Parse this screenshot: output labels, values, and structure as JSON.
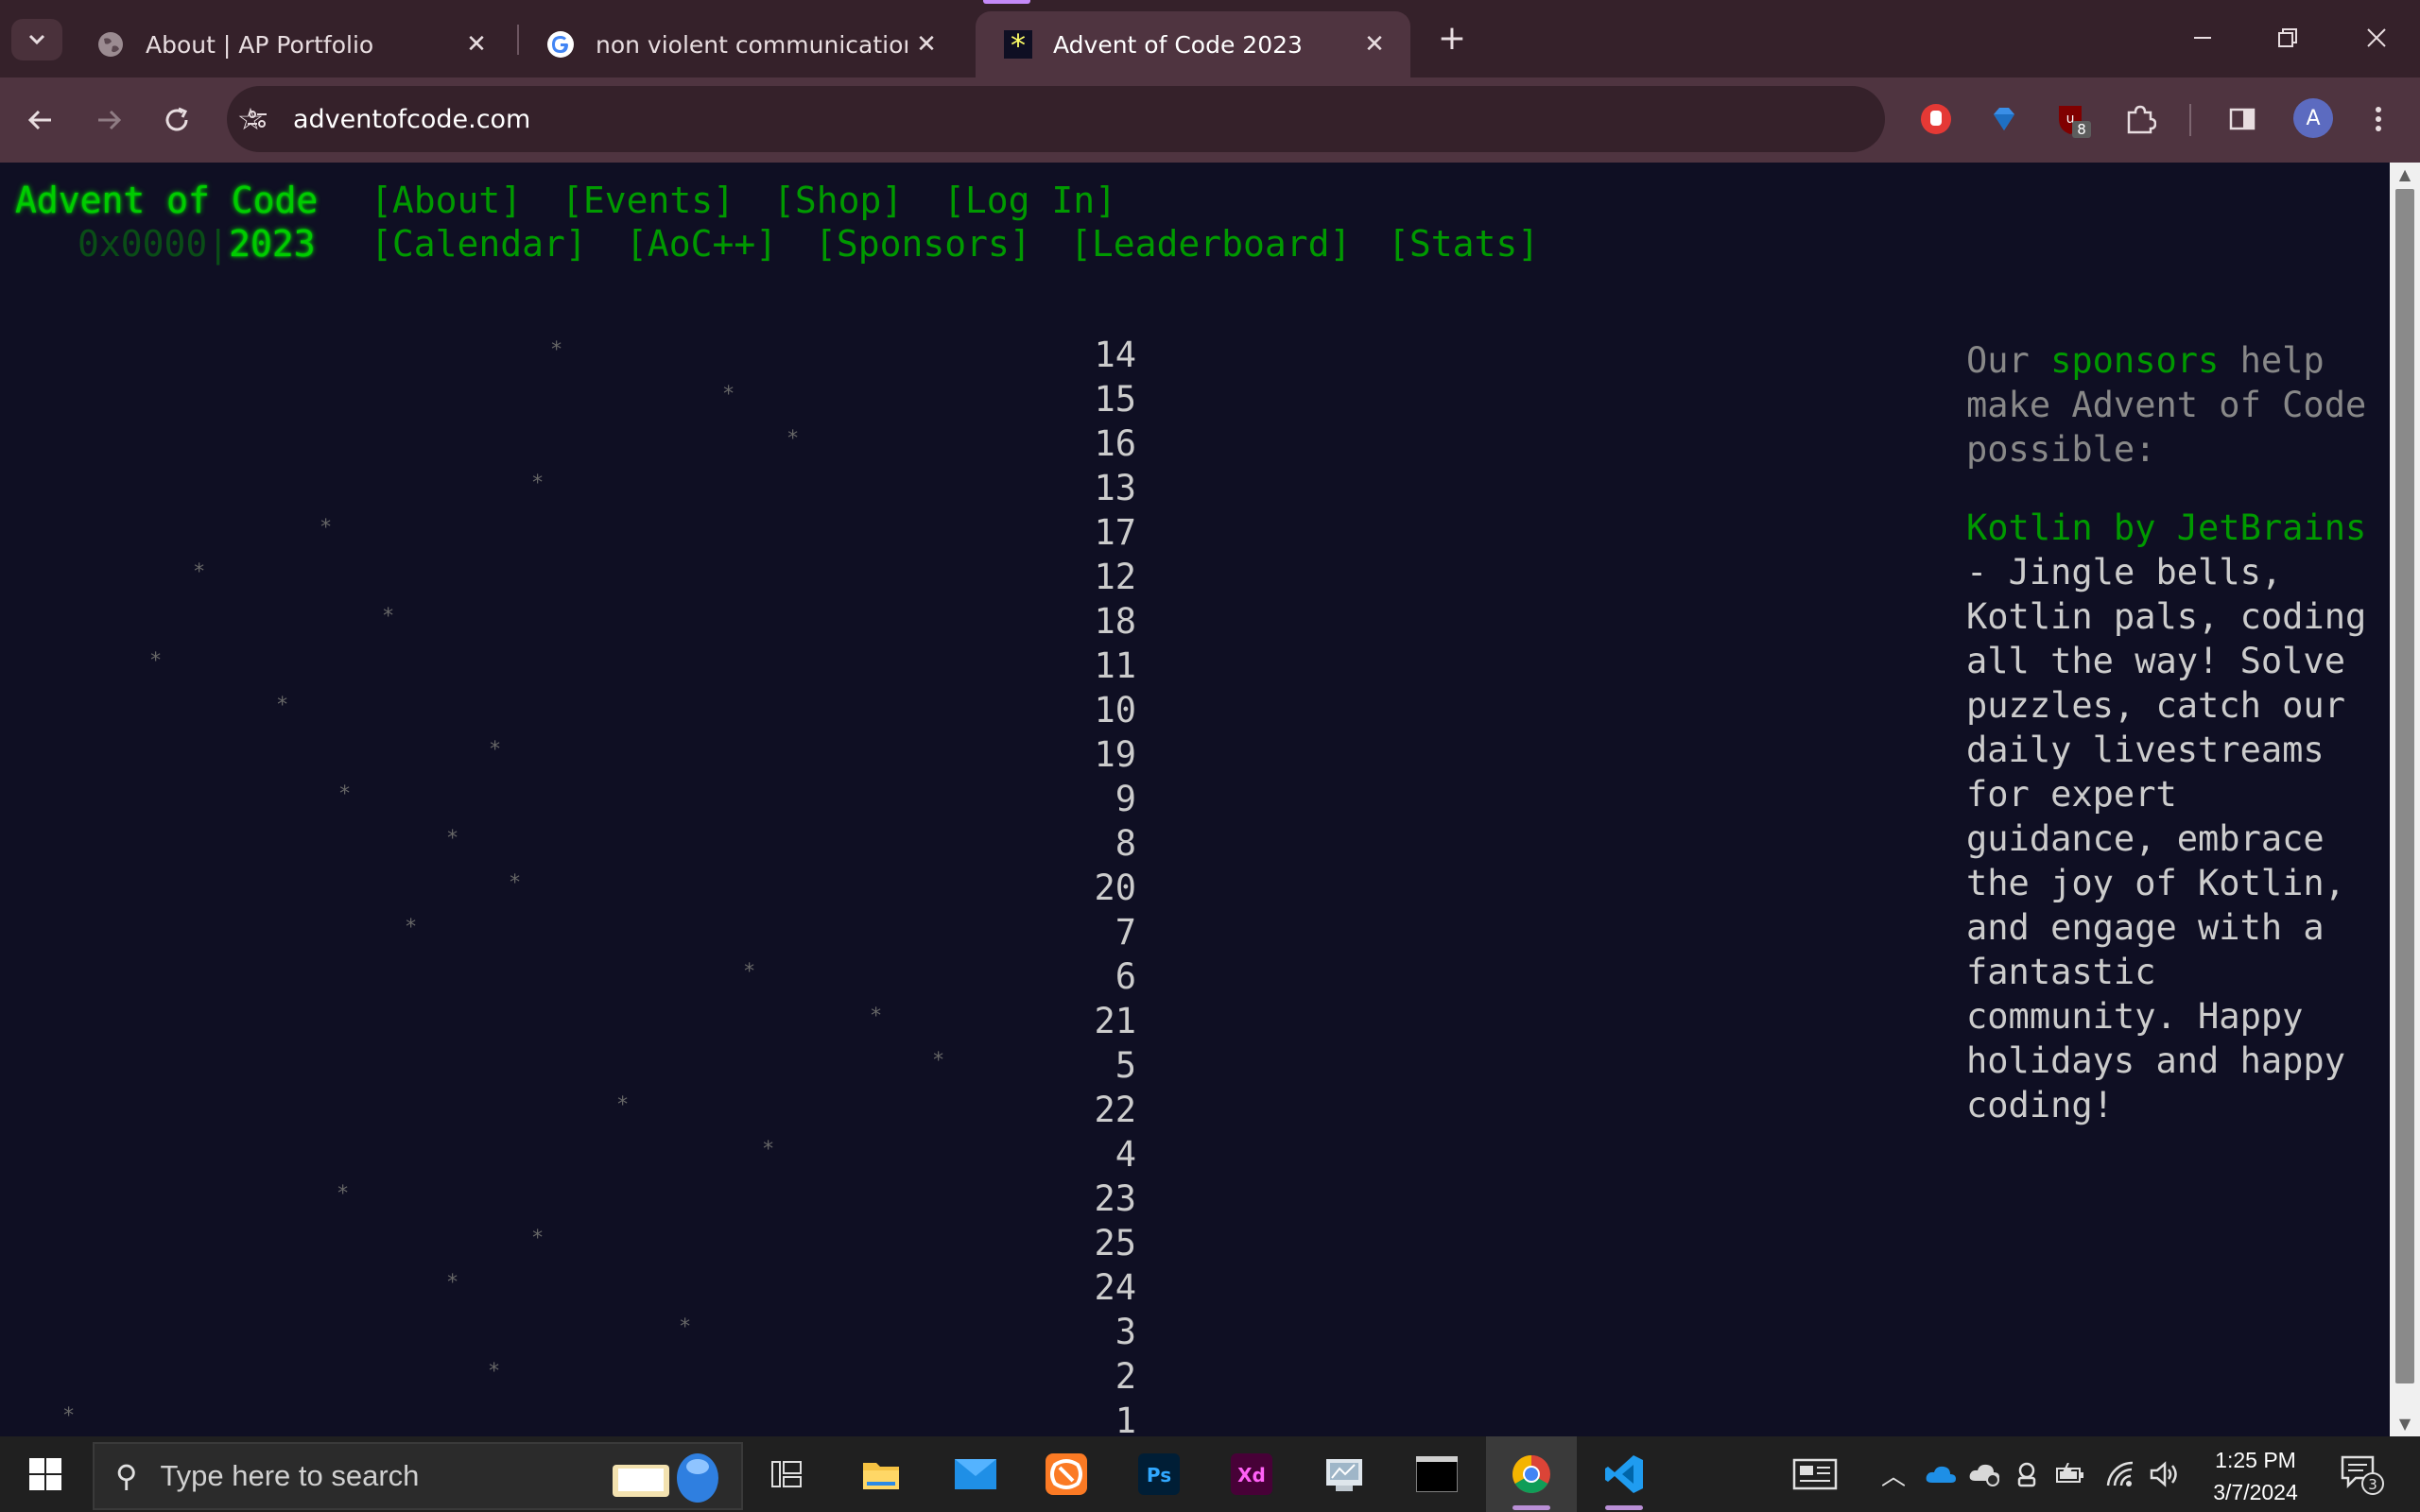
{
  "browser": {
    "tabs": [
      {
        "title": "About | AP Portfolio",
        "icon": "globe-icon",
        "active": false
      },
      {
        "title": "non violent communication - Google Search",
        "icon": "google-g-icon",
        "active": false
      },
      {
        "title": "Advent of Code 2023",
        "icon": "aoc-star-icon",
        "active": true
      }
    ],
    "url": "adventofcode.com",
    "extension_badge": "8",
    "profile_initial": "A"
  },
  "aoc": {
    "title": "Advent of Code",
    "year_prefix": "0x0000",
    "year_pipe": "|",
    "year": "2023",
    "nav_row1": [
      "[About]",
      "[Events]",
      "[Shop]",
      "[Log In]"
    ],
    "nav_row2": [
      "[Calendar]",
      "[AoC++]",
      "[Sponsors]",
      "[Leaderboard]",
      "[Stats]"
    ],
    "star_glyph": "*",
    "calendar_days": [
      "14",
      "15",
      "16",
      "13",
      "17",
      "12",
      "18",
      "11",
      "10",
      "19",
      "9",
      "8",
      "20",
      "7",
      "6",
      "21",
      "5",
      "22",
      "4",
      "23",
      "25",
      "24",
      "3",
      "2",
      "1"
    ],
    "sponsor": {
      "intro_before": "Our",
      "intro_link": "sponsors",
      "intro_after": "help make Advent of Code possible:",
      "name": "Kotlin by JetBrains",
      "dash": " -",
      "description": "Jingle bells, Kotlin pals, coding all the way! Solve puzzles, catch our daily livestreams for expert guidance, embrace the joy of Kotlin, and engage with a fantastic community. Happy holidays and happy coding!"
    }
  },
  "taskbar": {
    "search_placeholder": "Type here to search",
    "apps": [
      "task-view",
      "file-explorer",
      "mail",
      "xampp",
      "photoshop",
      "adobe-xd",
      "disk-utility",
      "terminal",
      "chrome",
      "vscode"
    ],
    "time": "1:25 PM",
    "date": "3/7/2024",
    "notification_count": "3"
  },
  "colors": {
    "page_bg": "#0f0f23",
    "aoc_green": "#00cc00",
    "link_green": "#009900",
    "text": "#cccccc",
    "muted": "#888888",
    "chrome_tabbar": "#35212a",
    "chrome_toolbar": "#4f3440"
  }
}
